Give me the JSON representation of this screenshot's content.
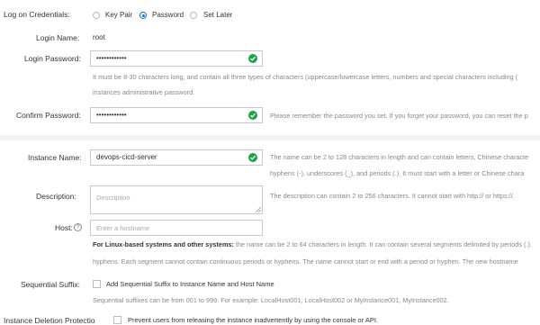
{
  "credentials": {
    "label": "Log on Credentials:",
    "options": [
      {
        "label": "Key Pair",
        "selected": false
      },
      {
        "label": "Password",
        "selected": true
      },
      {
        "label": "Set Later",
        "selected": false
      }
    ]
  },
  "login_name": {
    "label": "Login Name:",
    "value": "root"
  },
  "login_password": {
    "label": "Login Password:",
    "value": "••••••••••••",
    "hint_line1": "It must be 8-30 characters long, and contain all three types of characters (uppercase/lowercase letters, numbers and special characters including (",
    "hint_line2": "instances administrative password."
  },
  "confirm_password": {
    "label": "Confirm Password:",
    "value": "••••••••••••",
    "hint": "Please remember the password you set. If you forget your password, you can reset the p"
  },
  "instance_name": {
    "label": "Instance Name:",
    "value": "devops-cicd-server",
    "hint_line1": "The name can be 2 to 128 characters in length and can contain letters, Chinese characte",
    "hint_line2": "hyphens (-), underscores (_), and periods (.). It must start with a letter or Chinese chara"
  },
  "description": {
    "label": "Description:",
    "placeholder": "Description",
    "hint": "The description can contain 2 to 256 characters. It cannot start with http:// or https://."
  },
  "host": {
    "label": "Host:",
    "help": "?",
    "placeholder": "Enter a hostname",
    "hint_bold": "For Linux-based systems and other systems:",
    "hint_line1": " the name can be 2 to 64 characters in length. It can contain several segments delimited by periods (.).",
    "hint_line2": "hyphens. Each segment cannot contain continuous periods or hyphens. The name cannot start or end with a period or hyphen. The new hostname"
  },
  "sequential_suffix": {
    "label": "Sequential Suffix:",
    "checkbox_label": "Add Sequential Suffix to Instance Name and Host Name",
    "checked": false,
    "hint": "Sequential suffixes can be from 001 to 999. For example: LocalHost001, LocalHost002 or MyInstance001, MyInstance002."
  },
  "deletion_protection": {
    "label": "Instance Deletion Protectio",
    "checkbox_label": "Prevent users from releasing the instance inadvertently by using the console or API.",
    "checked": false
  },
  "colors": {
    "accent": "#0a74d8",
    "success": "#1aa34a"
  }
}
